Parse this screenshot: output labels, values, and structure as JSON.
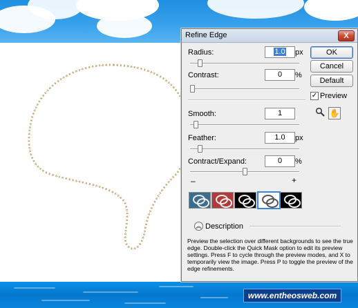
{
  "dialog": {
    "title": "Refine Edge",
    "close_label": "X",
    "buttons": {
      "ok": "OK",
      "cancel": "Cancel",
      "default": "Default"
    },
    "preview_checkbox": {
      "label": "Preview",
      "checked": true
    },
    "tools": {
      "zoom": "zoom-icon",
      "hand": "hand-icon"
    },
    "fields": {
      "radius": {
        "label": "Radius:",
        "value": "1.0",
        "unit": "px",
        "slider_fraction": 0.07
      },
      "contrast": {
        "label": "Contrast:",
        "value": "0",
        "unit": "%",
        "slider_fraction": 0.0
      },
      "smooth": {
        "label": "Smooth:",
        "value": "1",
        "unit": "",
        "slider_fraction": 0.03
      },
      "feather": {
        "label": "Feather:",
        "value": "1.0",
        "unit": "px",
        "slider_fraction": 0.07
      },
      "contract": {
        "label": "Contract/Expand:",
        "value": "0",
        "unit": "%",
        "slider_fraction": 0.5,
        "minus": "–",
        "plus": "+"
      }
    },
    "preview_modes": [
      {
        "name": "standard",
        "bg": "#3b6d8c"
      },
      {
        "name": "quick-mask",
        "bg": "#b23a3a"
      },
      {
        "name": "on-black",
        "bg": "#000000"
      },
      {
        "name": "on-white",
        "bg": "#ffffff",
        "active": true
      },
      {
        "name": "mask",
        "bg": "#000000"
      }
    ],
    "description": {
      "label": "Description",
      "text": "Preview the selection over different backgrounds to see the true edge. Double-click the Quick Mask option to edit its preview settings. Press F to cycle through the preview modes, and X to temporarily view the image. Press P to toggle the preview of the edge refinements."
    }
  },
  "watermark": "www.entheosweb.com"
}
